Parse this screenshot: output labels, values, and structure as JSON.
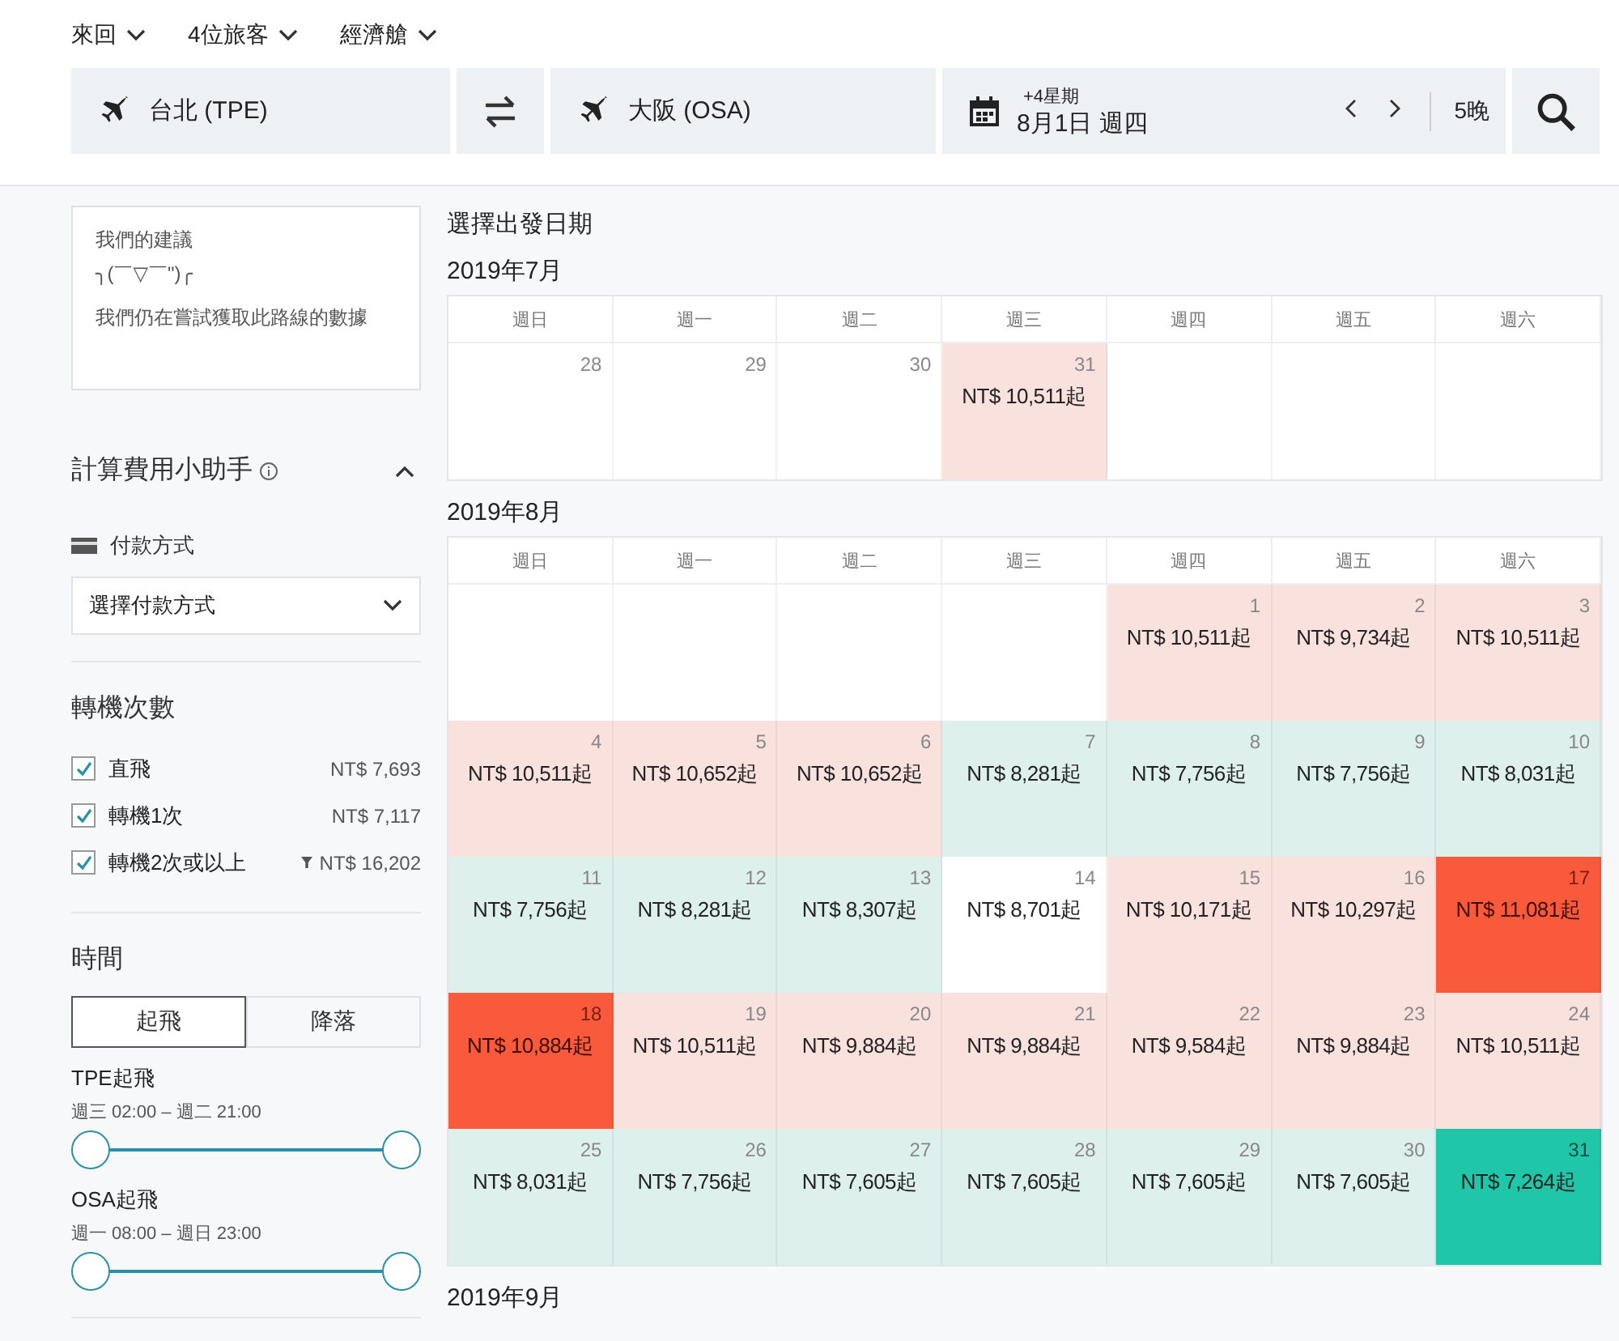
{
  "top_options": [
    {
      "label": "來回"
    },
    {
      "label": "4位旅客"
    },
    {
      "label": "經濟艙"
    }
  ],
  "search_bar": {
    "origin": "台北 (TPE)",
    "destination": "大阪 (OSA)",
    "date_flex": "+4星期",
    "date": "8月1日 週四",
    "nights": "5晚"
  },
  "sidebar": {
    "suggestion": {
      "title": "我們的建議",
      "emoticon": "╮(￣▽￣\")╭",
      "message": "我們仍在嘗試獲取此路線的數據"
    },
    "fee_helper": {
      "title": "計算費用小助手",
      "expanded": true,
      "payment_label": "付款方式",
      "payment_placeholder": "選擇付款方式"
    },
    "stops": {
      "title": "轉機次數",
      "options": [
        {
          "label": "直飛",
          "price": "NT$ 7,693",
          "checked": true,
          "filtered": false
        },
        {
          "label": "轉機1次",
          "price": "NT$ 7,117",
          "checked": true,
          "filtered": false
        },
        {
          "label": "轉機2次或以上",
          "price": "NT$ 16,202",
          "checked": true,
          "filtered": true
        }
      ]
    },
    "time": {
      "title": "時間",
      "tabs": [
        {
          "label": "起飛",
          "selected": true
        },
        {
          "label": "降落",
          "selected": false
        }
      ],
      "ranges": [
        {
          "label": "TPE起飛",
          "range": "週三 02:00 – 週二 21:00",
          "thumbs": [
            {
              "level": 0
            },
            {
              "level": 1
            }
          ]
        },
        {
          "label": "OSA起飛",
          "range": "週一 08:00 – 週日 23:00",
          "thumbs": [
            {
              "level": 0
            },
            {
              "level": 1
            }
          ]
        }
      ]
    }
  },
  "calendar": {
    "title": "選擇出發日期",
    "months": [
      {
        "title": "2019年7月",
        "weekdays": [
          "週日",
          "週一",
          "週二",
          "週三",
          "週四",
          "週五",
          "週六"
        ],
        "cells": [
          {
            "kind": "day",
            "day": "28"
          },
          {
            "kind": "day",
            "day": "29"
          },
          {
            "kind": "day",
            "day": "30"
          },
          {
            "kind": "day",
            "day": "31",
            "price": "NT$ 10,511起",
            "color": "#f9e1de"
          },
          {
            "kind": "blank"
          },
          {
            "kind": "blank"
          },
          {
            "kind": "blank"
          }
        ]
      },
      {
        "title": "2019年8月",
        "weekdays": [
          "週日",
          "週一",
          "週二",
          "週三",
          "週四",
          "週五",
          "週六"
        ],
        "cells": [
          {
            "kind": "blank"
          },
          {
            "kind": "blank"
          },
          {
            "kind": "blank"
          },
          {
            "kind": "blank"
          },
          {
            "kind": "day",
            "day": "1",
            "price": "NT$ 10,511起",
            "color": "#f9e1de"
          },
          {
            "kind": "day",
            "day": "2",
            "price": "NT$ 9,734起",
            "color": "#f9e1de"
          },
          {
            "kind": "day",
            "day": "3",
            "price": "NT$ 10,511起",
            "color": "#f9e1de"
          },
          {
            "kind": "day",
            "day": "4",
            "price": "NT$ 10,511起",
            "color": "#f9e1de"
          },
          {
            "kind": "day",
            "day": "5",
            "price": "NT$ 10,652起",
            "color": "#f9e1de"
          },
          {
            "kind": "day",
            "day": "6",
            "price": "NT$ 10,652起",
            "color": "#f9e1de"
          },
          {
            "kind": "day",
            "day": "7",
            "price": "NT$ 8,281起",
            "color": "#ddf0ec"
          },
          {
            "kind": "day",
            "day": "8",
            "price": "NT$ 7,756起",
            "color": "#ddf0ec"
          },
          {
            "kind": "day",
            "day": "9",
            "price": "NT$ 7,756起",
            "color": "#ddf0ec"
          },
          {
            "kind": "day",
            "day": "10",
            "price": "NT$ 8,031起",
            "color": "#ddf0ec"
          },
          {
            "kind": "day",
            "day": "11",
            "price": "NT$ 7,756起",
            "color": "#ddf0ec"
          },
          {
            "kind": "day",
            "day": "12",
            "price": "NT$ 8,281起",
            "color": "#ddf0ec"
          },
          {
            "kind": "day",
            "day": "13",
            "price": "NT$ 8,307起",
            "color": "#ddf0ec"
          },
          {
            "kind": "day",
            "day": "14",
            "price": "NT$ 8,701起",
            "color": "#ffffff"
          },
          {
            "kind": "day",
            "day": "15",
            "price": "NT$ 10,171起",
            "color": "#f9e1de"
          },
          {
            "kind": "day",
            "day": "16",
            "price": "NT$ 10,297起",
            "color": "#f9e1de"
          },
          {
            "kind": "day",
            "day": "17",
            "price": "NT$ 11,081起",
            "color": "#fa5a3c"
          },
          {
            "kind": "day",
            "day": "18",
            "price": "NT$ 10,884起",
            "color": "#fa5a3c"
          },
          {
            "kind": "day",
            "day": "19",
            "price": "NT$ 10,511起",
            "color": "#f9e1de"
          },
          {
            "kind": "day",
            "day": "20",
            "price": "NT$ 9,884起",
            "color": "#f9e1de"
          },
          {
            "kind": "day",
            "day": "21",
            "price": "NT$ 9,884起",
            "color": "#f9e1de"
          },
          {
            "kind": "day",
            "day": "22",
            "price": "NT$ 9,584起",
            "color": "#f9e1de"
          },
          {
            "kind": "day",
            "day": "23",
            "price": "NT$ 9,884起",
            "color": "#f9e1de"
          },
          {
            "kind": "day",
            "day": "24",
            "price": "NT$ 10,511起",
            "color": "#f9e1de"
          },
          {
            "kind": "day",
            "day": "25",
            "price": "NT$ 8,031起",
            "color": "#ddf0ec"
          },
          {
            "kind": "day",
            "day": "26",
            "price": "NT$ 7,756起",
            "color": "#ddf0ec"
          },
          {
            "kind": "day",
            "day": "27",
            "price": "NT$ 7,605起",
            "color": "#ddf0ec"
          },
          {
            "kind": "day",
            "day": "28",
            "price": "NT$ 7,605起",
            "color": "#ddf0ec"
          },
          {
            "kind": "day",
            "day": "29",
            "price": "NT$ 7,605起",
            "color": "#ddf0ec"
          },
          {
            "kind": "day",
            "day": "30",
            "price": "NT$ 7,605起",
            "color": "#ddf0ec"
          },
          {
            "kind": "day",
            "day": "31",
            "price": "NT$ 7,264起",
            "color": "#1fc6a8"
          }
        ]
      },
      {
        "title": "2019年9月"
      }
    ]
  }
}
